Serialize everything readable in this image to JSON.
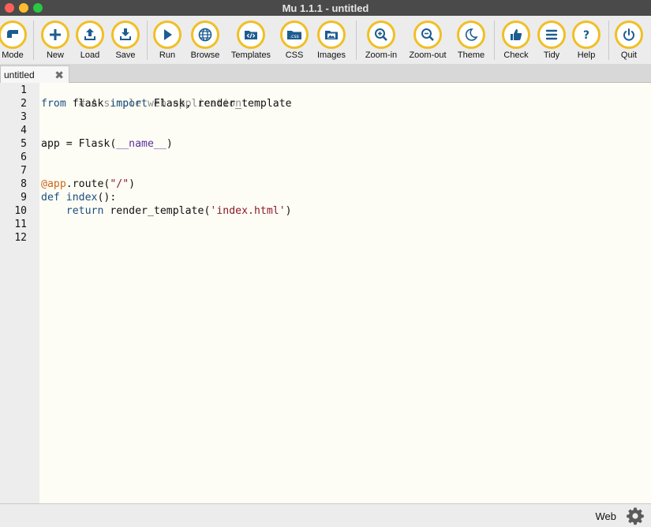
{
  "window": {
    "title": "Mu 1.1.1 - untitled"
  },
  "toolbar": {
    "buttons": [
      {
        "label": "Mode",
        "icon": "mode-icon"
      },
      {
        "label": "New",
        "icon": "plus-icon"
      },
      {
        "label": "Load",
        "icon": "upload-icon"
      },
      {
        "label": "Save",
        "icon": "download-icon"
      },
      {
        "label": "Run",
        "icon": "play-icon"
      },
      {
        "label": "Browse",
        "icon": "globe-icon"
      },
      {
        "label": "Templates",
        "icon": "code-folder-icon"
      },
      {
        "label": "CSS",
        "icon": "css-folder-icon"
      },
      {
        "label": "Images",
        "icon": "image-folder-icon"
      },
      {
        "label": "Zoom-in",
        "icon": "zoom-in-icon"
      },
      {
        "label": "Zoom-out",
        "icon": "zoom-out-icon"
      },
      {
        "label": "Theme",
        "icon": "moon-icon"
      },
      {
        "label": "Check",
        "icon": "thumbs-up-icon"
      },
      {
        "label": "Tidy",
        "icon": "lines-icon"
      },
      {
        "label": "Help",
        "icon": "question-icon"
      },
      {
        "label": "Quit",
        "icon": "power-icon"
      }
    ],
    "accent_color": "#f1bf25",
    "icon_color": "#1d5c8f"
  },
  "tabs": [
    {
      "label": "untitled",
      "close_icon": "close-icon"
    }
  ],
  "editor": {
    "line_numbers": [
      "1",
      "2",
      "3",
      "4",
      "5",
      "6",
      "7",
      "8",
      "9",
      "10",
      "11",
      "12"
    ],
    "lines": {
      "l1": "# A simple web application.",
      "l2a": "from",
      "l2b": " flask ",
      "l2c": "import",
      "l2d": " Flask, render_template",
      "l5a": "app = Flask(",
      "l5b": "__name__",
      "l5c": ")",
      "l8a": "@app",
      "l8b": ".route(",
      "l8c": "\"/\"",
      "l8d": ")",
      "l9a": "def",
      "l9b": " index",
      "l9c": "():",
      "l10a": "    ",
      "l10b": "return",
      "l10c": " render_template(",
      "l10d": "'index.html'",
      "l10e": ")"
    }
  },
  "statusbar": {
    "mode": "Web",
    "settings_icon": "gear-icon"
  }
}
